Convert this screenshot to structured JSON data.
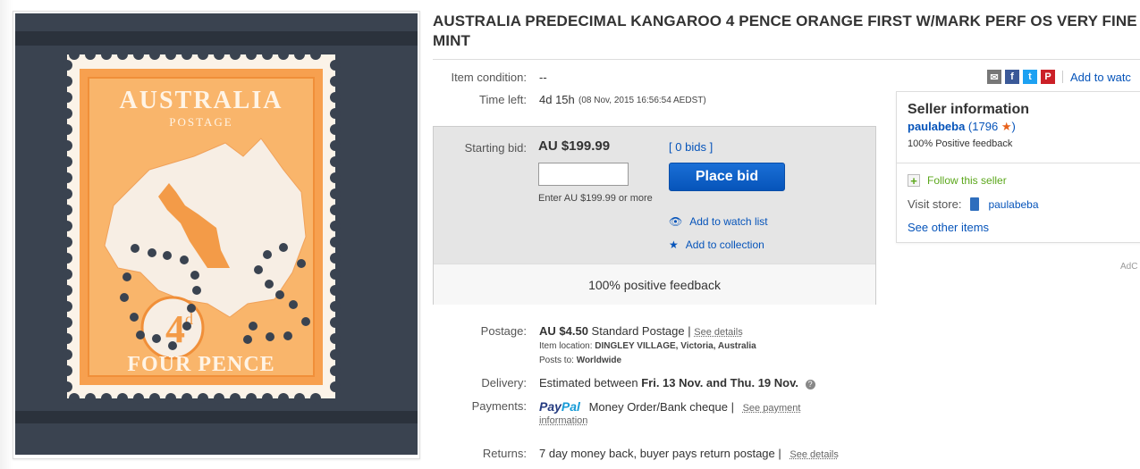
{
  "title": "AUSTRALIA PREDECIMAL KANGAROO 4 PENCE ORANGE FIRST W/MARK PERF OS VERY FINE MINT",
  "stamp": {
    "country": "AUSTRALIA",
    "postage": "POSTAGE",
    "denomination": "4",
    "unit": "d",
    "value_text": "FOUR PENCE"
  },
  "item": {
    "condition_label": "Item condition:",
    "condition_value": "--",
    "time_left_label": "Time left:",
    "time_left_value": "4d 15h",
    "time_left_detail": "(08 Nov, 2015   16:56:54 AEDST)"
  },
  "share": {
    "add_to_watch": "Add to watc"
  },
  "bid": {
    "starting_label": "Starting bid:",
    "starting_value": "AU $199.99",
    "bids_open": "[",
    "bids_link": "0 bids",
    "bids_close": "]",
    "input_value": "",
    "hint": "Enter AU $199.99 or more",
    "place_bid": "Place bid",
    "add_watch": "Add to watch list",
    "add_collection": "Add to collection",
    "feedback": "100% positive feedback"
  },
  "postage": {
    "label": "Postage:",
    "amount": "AU $4.50",
    "service": "Standard Postage",
    "sep": "|",
    "see_details": "See details",
    "location_label": "Item location:",
    "location_value": "DINGLEY VILLAGE, Victoria, Australia",
    "posts_to_label": "Posts to:",
    "posts_to_value": "Worldwide"
  },
  "delivery": {
    "label": "Delivery:",
    "prefix": "Estimated between",
    "dates": "Fri. 13 Nov. and Thu. 19 Nov."
  },
  "payments": {
    "label": "Payments:",
    "paypal_pay": "Pay",
    "paypal_pal": "Pal",
    "methods": "Money Order/Bank cheque",
    "sep": "|",
    "see_payment": "See payment",
    "information": "information"
  },
  "returns": {
    "label": "Returns:",
    "value": "7 day money back, buyer pays return postage",
    "sep": "|",
    "see_details": "See details"
  },
  "seller": {
    "heading": "Seller information",
    "name": "paulabeba",
    "open": "(",
    "score": "1796",
    "close": ")",
    "feedback": "100% Positive feedback",
    "follow": "Follow this seller",
    "visit_label": "Visit store:",
    "store_name": "paulabeba",
    "other_items": "See other items"
  },
  "ad_label": "AdC",
  "colors": {
    "link": "#0654ba",
    "button": "#0654ba",
    "stamp_orange": "#f7a04f",
    "paypal_dark": "#253b80",
    "paypal_light": "#179bd7",
    "star": "#e8611a"
  }
}
